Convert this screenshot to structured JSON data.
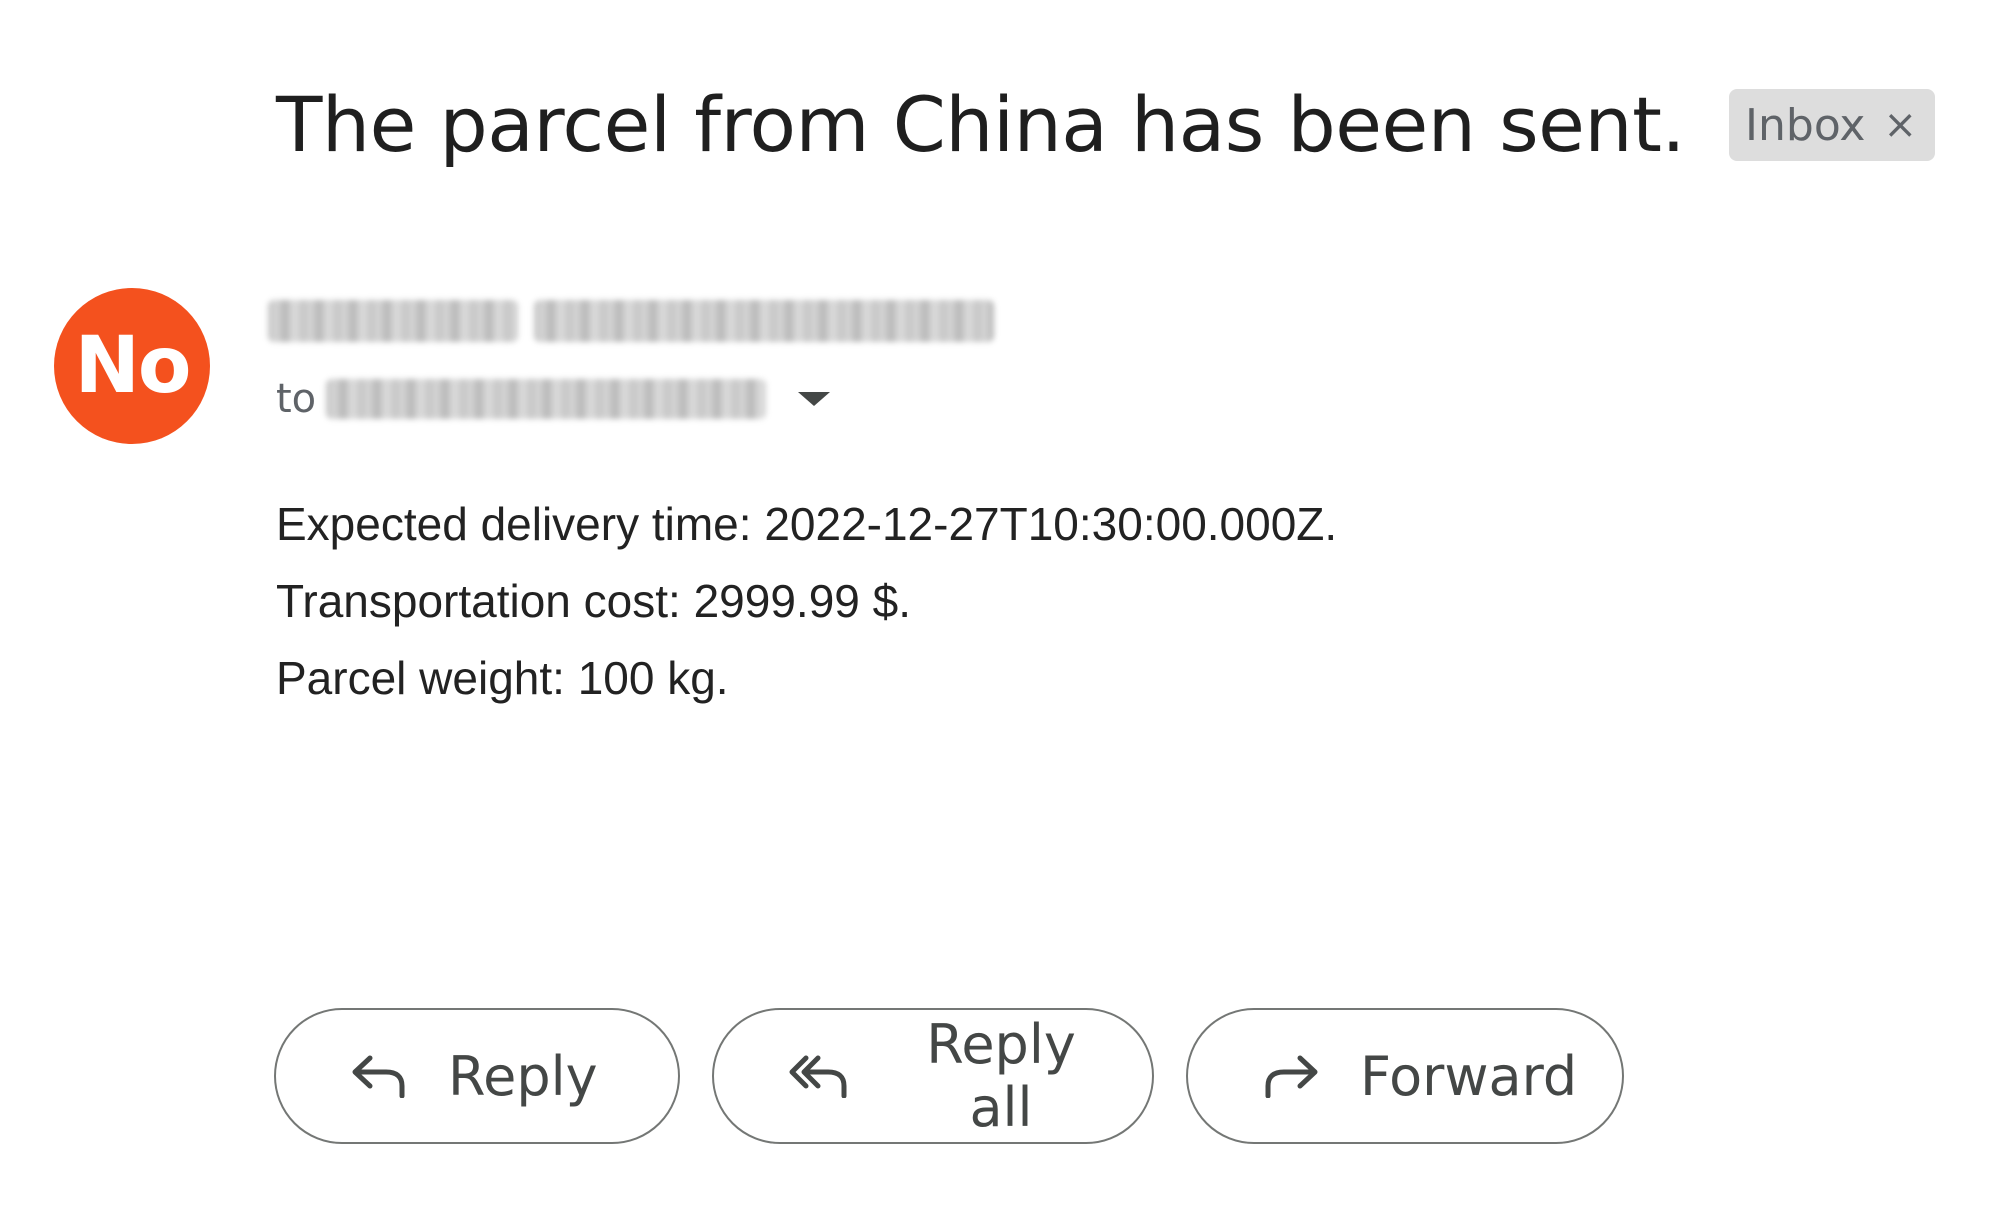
{
  "email": {
    "subject": "The parcel from China has been sent.",
    "label": "Inbox",
    "label_remove": "×",
    "sender": {
      "avatar_initials": "No",
      "avatar_color": "#f4511e"
    },
    "recipient_prefix": "to",
    "body": {
      "lines": [
        "Expected delivery time: 2022-12-27T10:30:00.000Z.",
        "Transportation cost: 2999.99 $.",
        "Parcel weight: 100 kg."
      ]
    }
  },
  "actions": {
    "reply": {
      "label": "Reply",
      "icon": "reply-icon"
    },
    "reply_all": {
      "label": "Reply all",
      "icon": "reply-all-icon"
    },
    "forward": {
      "label": "Forward",
      "icon": "forward-icon"
    }
  }
}
